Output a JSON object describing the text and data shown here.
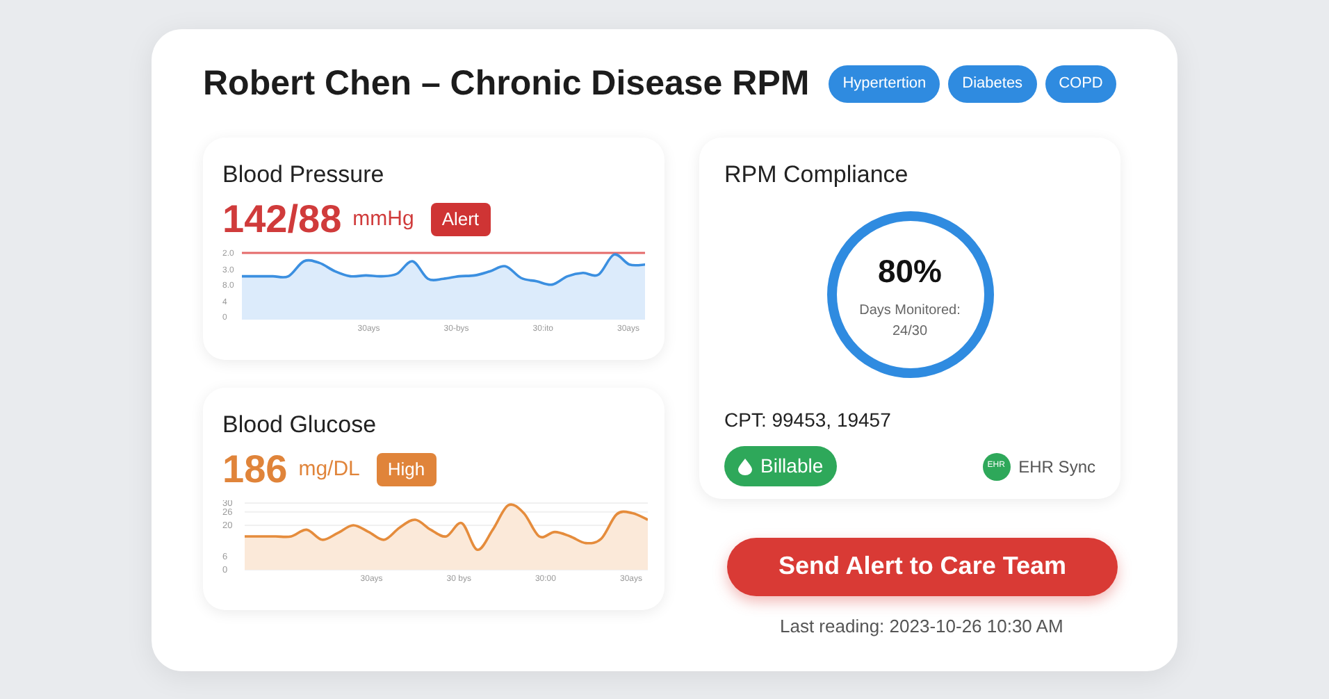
{
  "header": {
    "title": "Robert Chen – Chronic Disease RPM",
    "tags": [
      "Hypertertion",
      "Diabetes",
      "COPD"
    ]
  },
  "vitals": [
    {
      "kind": "pressure",
      "title": "Blood Pressure",
      "value": "142/88",
      "unit": "mmHg",
      "badge": "Alert",
      "y_labels": [
        "2.0",
        "3.0",
        "8.0",
        "4",
        "0"
      ],
      "x_labels": [
        "30ays",
        "30-bys",
        "30:ito",
        "30ays"
      ]
    },
    {
      "kind": "glucose",
      "title": "Blood Glucose",
      "value": "186",
      "unit": "mg/DL",
      "badge": "High",
      "x_labels": [
        "30ays",
        "30 bys",
        "30:00",
        "30ays"
      ],
      "chart_data": {
        "type": "area",
        "ylim": [
          0,
          30
        ],
        "yticks": [
          0,
          6,
          20,
          26,
          30
        ],
        "series": [
          {
            "color": "#e58c3c",
            "values": [
              15,
              15,
              15,
              15,
              18,
              13.5,
              16.5,
              20,
              17,
              13.5,
              19,
              22.5,
              18,
              15,
              21,
              9,
              18,
              29,
              25.5,
              15,
              17,
              15,
              12,
              14,
              25,
              25.5,
              22.5
            ]
          }
        ]
      }
    }
  ],
  "compliance": {
    "title": "RPM Compliance",
    "percent": "80%",
    "caption": "Days Monitored:",
    "days": "24/30",
    "cpt": "CPT: 99453, 19457",
    "billable": "Billable",
    "ehr_icon": "EHR",
    "ehr": "EHR Sync"
  },
  "action": {
    "button": "Send Alert to Care Team",
    "last_reading": "Last reading: 2023-10-26 10:30 AM"
  }
}
